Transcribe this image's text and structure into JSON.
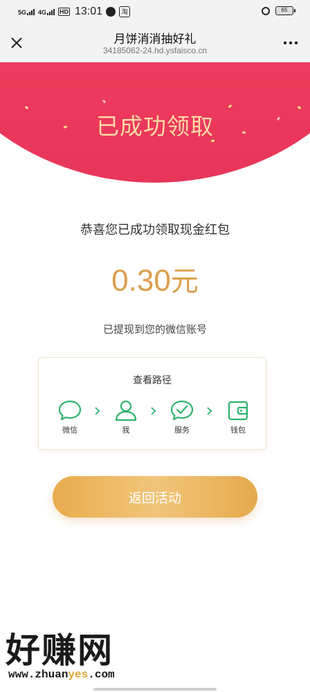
{
  "status_bar": {
    "network_1": "5G",
    "network_2": "4G",
    "hd": "HD",
    "time": "13:01",
    "app_icon_2": "淘",
    "battery": "65"
  },
  "nav": {
    "title": "月饼消消抽好礼",
    "url": "34185062-24.hd.ysfaisco.cn",
    "close_icon": "close-icon",
    "more_icon": "more-icon"
  },
  "banner": {
    "title": "已成功领取",
    "colors": {
      "bg": "#ef3d5f",
      "title": "#ffd9a6"
    }
  },
  "main": {
    "congrats": "恭喜您已成功领取现金红包",
    "amount": "0.30",
    "amount_unit": "元",
    "withdrawn": "已提现到您的微信账号",
    "accent_color": "#dc9f4c"
  },
  "path": {
    "title": "查看路径",
    "steps": [
      {
        "label": "微信",
        "icon": "chat-bubble-icon"
      },
      {
        "label": "我",
        "icon": "person-icon"
      },
      {
        "label": "服务",
        "icon": "check-bubble-icon"
      },
      {
        "label": "钱包",
        "icon": "wallet-icon"
      }
    ],
    "icon_color": "#2cb36b"
  },
  "button": {
    "label": "返回活动"
  },
  "watermark": {
    "top": "好赚网",
    "url_prefix": "www.zhuan",
    "url_mid": "yes",
    "url_suffix": ".com"
  }
}
